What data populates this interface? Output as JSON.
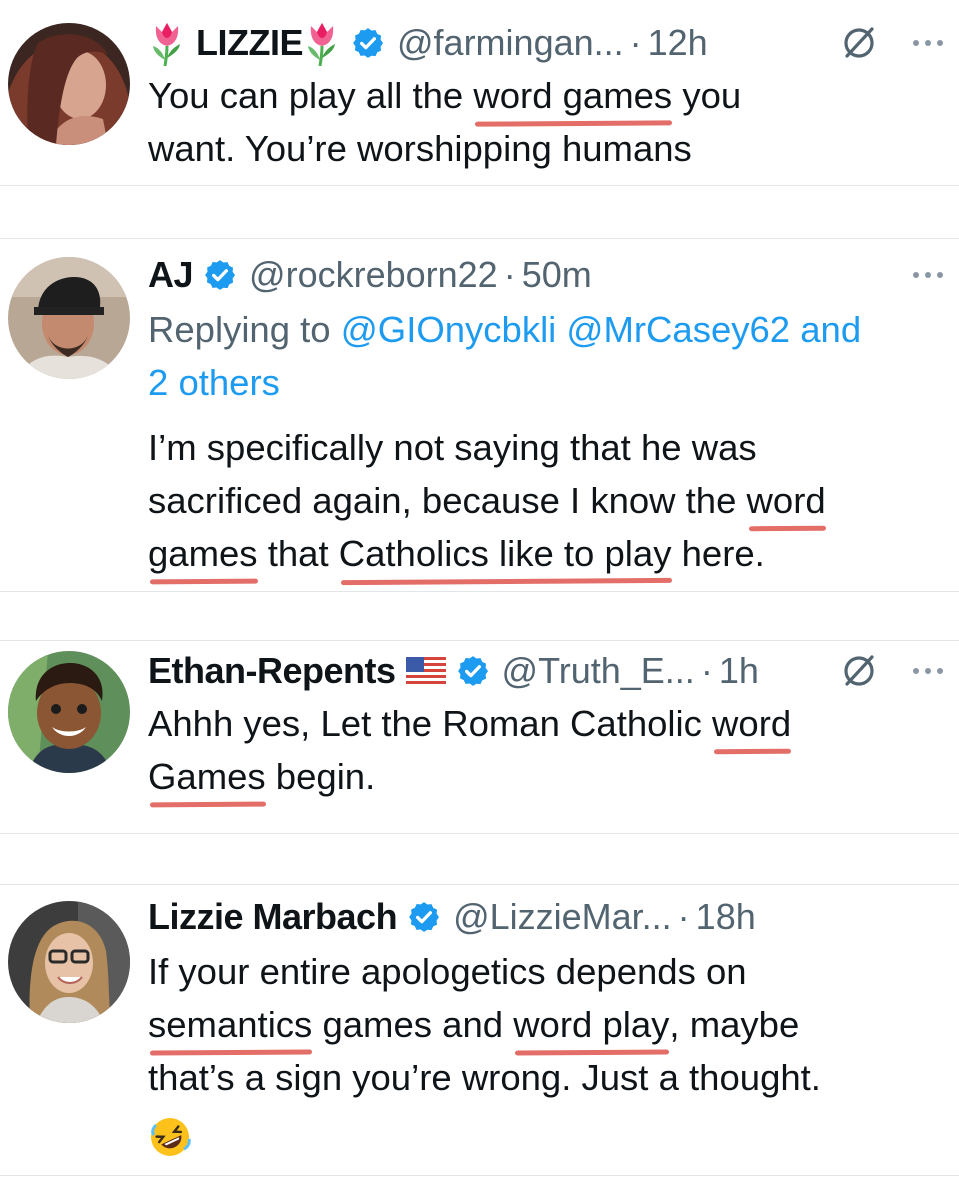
{
  "tweets": [
    {
      "name": "LIZZIE",
      "handle": "@farmingan...",
      "time": "12h",
      "dot": "·",
      "lines": [
        [
          "You can play all the ",
          {
            "u": "word games"
          },
          " you"
        ],
        [
          "want. You’re worshipping humans"
        ]
      ]
    },
    {
      "name": "AJ",
      "handle": "@rockreborn22",
      "time": "50m",
      "dot": "·",
      "reply_prefix": "Replying to ",
      "reply_mentions": "@GIOnycbkli @MrCasey62 and",
      "reply_more": "2 others",
      "lines": [
        [
          "I’m specifically not saying that he was"
        ],
        [
          "sacrificed again, because I know the ",
          {
            "u": "word"
          }
        ],
        [
          {
            "u": "games"
          },
          " that ",
          {
            "u": "Catholics like to play"
          },
          " here."
        ]
      ]
    },
    {
      "name": "Ethan-Repents",
      "handle": "@Truth_E...",
      "time": "1h",
      "dot": "·",
      "lines": [
        [
          "Ahhh yes, Let the Roman Catholic ",
          {
            "u": "word"
          }
        ],
        [
          {
            "u": "Games"
          },
          " begin."
        ]
      ]
    },
    {
      "name": "Lizzie Marbach",
      "handle": "@LizzieMar...",
      "time": "18h",
      "dot": "·",
      "lines": [
        [
          "If your entire apologetics depends on"
        ],
        [
          {
            "u": "semantics"
          },
          " games and ",
          {
            "u": "word play"
          },
          ", maybe"
        ],
        [
          "that’s a sign you’re wrong. Just a thought."
        ]
      ]
    }
  ],
  "icons": {
    "verified": "verified-badge-icon",
    "grok": "grok-icon",
    "more": "more-options-icon",
    "tulip": "tulip-emoji",
    "flag": "us-flag-emoji",
    "laugh": "rolling-laughing-emoji"
  },
  "colors": {
    "verified_blue": "#1d9bf0",
    "underline_red": "#e36e67",
    "secondary_text": "#536471"
  }
}
